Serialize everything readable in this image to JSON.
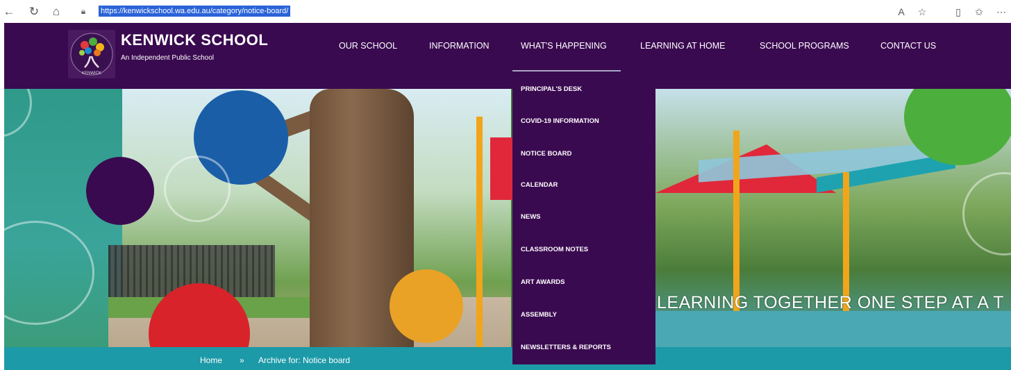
{
  "browser": {
    "url": "https://kenwickschool.wa.edu.au/category/notice-board/",
    "icons": [
      "back-icon",
      "refresh-icon",
      "home-icon",
      "lock-icon",
      "read-aloud-icon",
      "favorite-star-icon",
      "split-screen-icon",
      "favorites-icon"
    ]
  },
  "header": {
    "title": "KENWICK SCHOOL",
    "tagline": "An Independent Public School",
    "background": "#3a0a50"
  },
  "nav": {
    "items": [
      {
        "label": "OUR SCHOOL"
      },
      {
        "label": "INFORMATION"
      },
      {
        "label": "WHAT'S HAPPENING"
      },
      {
        "label": "LEARNING AT HOME"
      },
      {
        "label": "SCHOOL PROGRAMS"
      },
      {
        "label": "CONTACT US"
      }
    ],
    "active": "WHAT'S HAPPENING"
  },
  "dropdown": {
    "items": [
      {
        "label": "PRINCIPAL'S DESK"
      },
      {
        "label": "COVID-19 INFORMATION"
      },
      {
        "label": "NOTICE BOARD"
      },
      {
        "label": "CALENDAR"
      },
      {
        "label": "NEWS"
      },
      {
        "label": "CLASSROOM NOTES"
      },
      {
        "label": "ART AWARDS"
      },
      {
        "label": "ASSEMBLY"
      },
      {
        "label": "NEWSLETTERS & REPORTS"
      }
    ]
  },
  "hero": {
    "slogan": "LEARNING TOGETHER ONE STEP AT A T"
  },
  "breadcrumb": {
    "home": "Home",
    "separator": "»",
    "current": "Archive for: Notice board"
  },
  "colors": {
    "purple": "#3a0a50",
    "teal": "#1c9aa8",
    "blue_circle": "#1a5ea8",
    "red_circle": "#d8232a",
    "orange_circle": "#eaa226",
    "green_circle": "#4cae3c"
  }
}
